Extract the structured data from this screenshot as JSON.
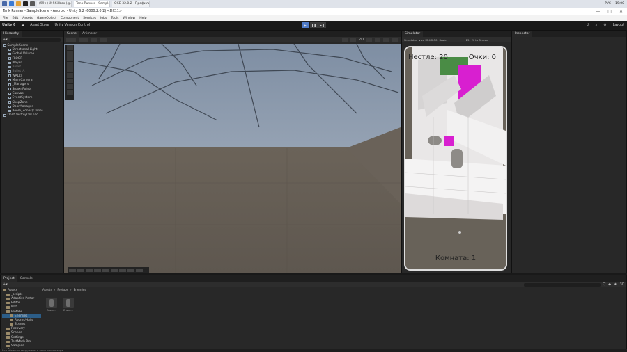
{
  "taskbar": {
    "tabs": [
      "(99+) ✆ SKillbox (@...",
      "Tank Runner - Sample...",
      "ОКБ 32.0.2 - Профиль..."
    ],
    "lang": "РУС",
    "time": "19:00"
  },
  "window": {
    "title": "Tank Runner - SampleScene - Android - Unity 6.2 (6000.2.0f2) <DX11>",
    "controls": [
      "—",
      "□",
      "✕"
    ]
  },
  "menu": [
    "File",
    "Edit",
    "Assets",
    "GameObject",
    "Component",
    "Services",
    "Jobs",
    "Tools",
    "Window",
    "Help"
  ],
  "toolbar": {
    "account": "Unity 6",
    "asset_store": "Asset Store",
    "version_control": "Unity Version Control",
    "layout": "Layout"
  },
  "hierarchy": {
    "tab": "Hierarchy",
    "items": [
      {
        "label": "SampleScene",
        "indent": 0,
        "dim": false
      },
      {
        "label": "Directional Light",
        "indent": 1,
        "dim": false
      },
      {
        "label": "Global Volume",
        "indent": 1,
        "dim": false
      },
      {
        "label": "FLOOR",
        "indent": 1,
        "dim": false
      },
      {
        "label": "Player",
        "indent": 1,
        "dim": false
      },
      {
        "label": "Bullet",
        "indent": 1,
        "dim": true
      },
      {
        "label": "Bullet_A",
        "indent": 1,
        "dim": true
      },
      {
        "label": "WALLS",
        "indent": 1,
        "dim": false
      },
      {
        "label": "Main Camera",
        "indent": 1,
        "dim": false
      },
      {
        "label": "_Managers",
        "indent": 1,
        "dim": false
      },
      {
        "label": "SpawnPoints",
        "indent": 1,
        "dim": false
      },
      {
        "label": "Canvas",
        "indent": 1,
        "dim": false
      },
      {
        "label": "EventSystem",
        "indent": 1,
        "dim": false
      },
      {
        "label": "ShopZone",
        "indent": 1,
        "dim": false
      },
      {
        "label": "DoorManager",
        "indent": 1,
        "dim": false
      },
      {
        "label": "Room_Zones(Clone)",
        "indent": 1,
        "dim": false
      },
      {
        "label": "DontDestroyOnLoad",
        "indent": 0,
        "dim": false
      }
    ]
  },
  "scene": {
    "tabs": [
      "Scene",
      "Animator"
    ],
    "mode_2d": "2D"
  },
  "simulator": {
    "tab": "Simulator",
    "mode": "Simulator",
    "device": "vivo X24 2.50",
    "scale_label": "Scale",
    "scale_value": "25",
    "fit": "Fit to Screen",
    "hud": {
      "lives": "Нестле: 20",
      "score": "Очки: 0",
      "room": "Комната: 1"
    }
  },
  "inspector": {
    "tab": "Inspector"
  },
  "project": {
    "tabs": [
      "Project",
      "Console"
    ],
    "tree": [
      {
        "label": "Assets",
        "indent": 0
      },
      {
        "label": "_scripts",
        "indent": 1
      },
      {
        "label": "Adaptive Perfor",
        "indent": 1
      },
      {
        "label": "Editor",
        "indent": 1
      },
      {
        "label": "Mat",
        "indent": 1
      },
      {
        "label": "Prefabs",
        "indent": 1
      },
      {
        "label": "Enemies",
        "indent": 2
      },
      {
        "label": "Rooms/Halls",
        "indent": 2
      },
      {
        "label": "Scenes",
        "indent": 2
      },
      {
        "label": "Recovery",
        "indent": 1
      },
      {
        "label": "Scenes",
        "indent": 1
      },
      {
        "label": "Settings",
        "indent": 1
      },
      {
        "label": "TextMesh Pro",
        "indent": 1
      },
      {
        "label": "Samples",
        "indent": 1
      },
      {
        "label": "Packages",
        "indent": 0
      }
    ],
    "breadcrumb": [
      "Assets",
      "Prefabs",
      "Enemies"
    ],
    "assets": [
      "Enem...",
      "Enem..."
    ],
    "count": "30",
    "status": "Все объекты загружены в окне инспектора"
  }
}
